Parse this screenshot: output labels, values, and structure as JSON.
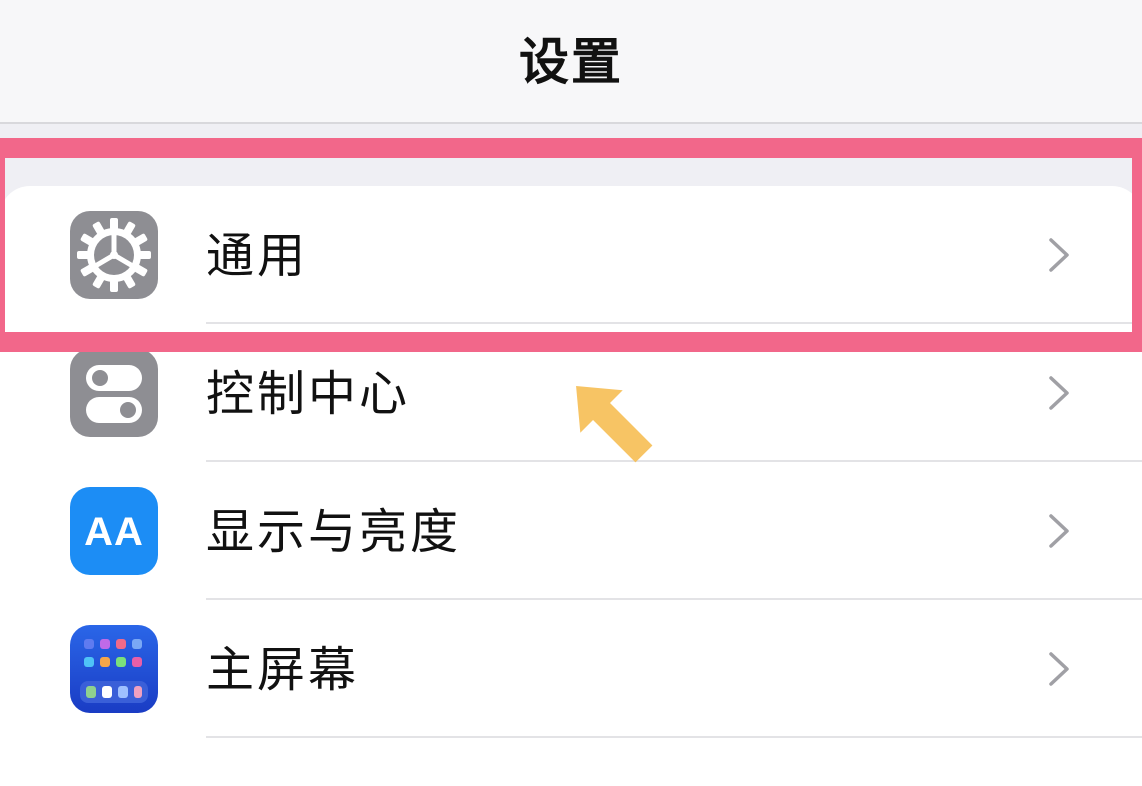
{
  "header": {
    "title": "设置"
  },
  "settings": {
    "items": [
      {
        "label": "通用",
        "icon": "gear-icon"
      },
      {
        "label": "控制中心",
        "icon": "toggle-switches-icon"
      },
      {
        "label": "显示与亮度",
        "icon": "text-size-icon",
        "icon_text": "AA"
      },
      {
        "label": "主屏幕",
        "icon": "home-screen-grid-icon"
      }
    ]
  },
  "annotation": {
    "highlight_color": "#f2678a",
    "arrow_color": "#f6be53",
    "highlighted_item": "通用"
  },
  "colors": {
    "background": "#efeff4",
    "card": "#ffffff",
    "icon_gray": "#8e8e93",
    "icon_blue": "#1c8df5",
    "icon_dark_blue": "#1c4fd6",
    "chevron": "#a0a0a5"
  }
}
